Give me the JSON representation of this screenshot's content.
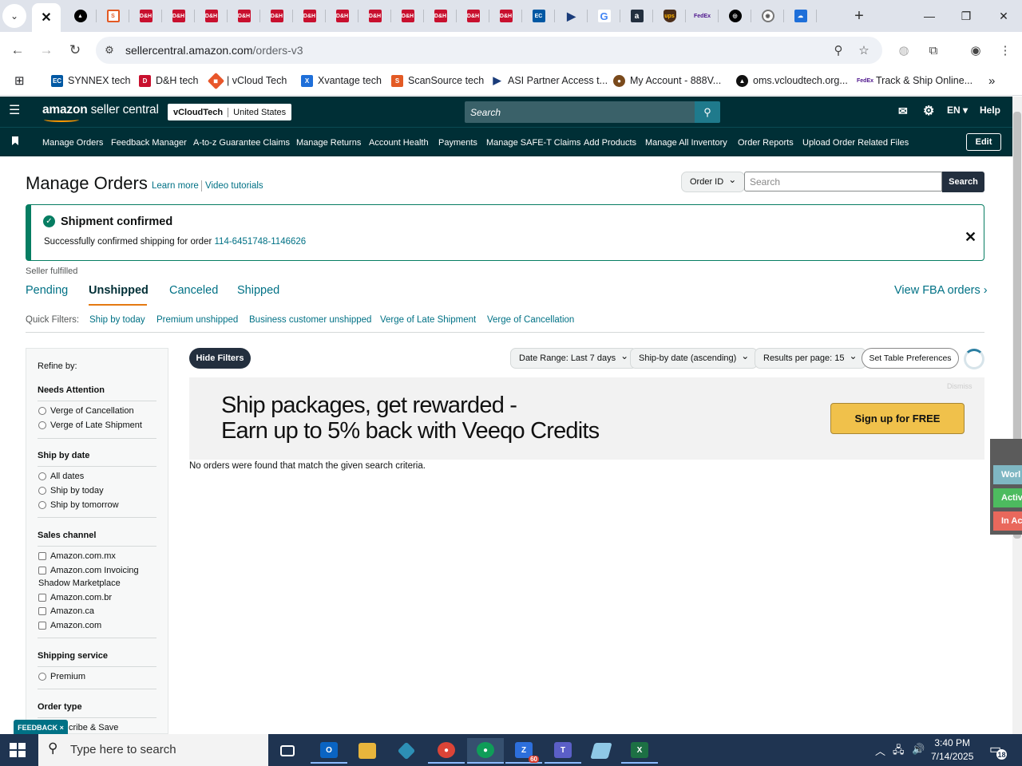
{
  "browser": {
    "url_domain": "sellercentral.amazon.com",
    "url_path": "/orders-v3",
    "favicons": [
      "tab-sellercentral",
      "tab-sharepoint",
      "tab-stackbit",
      "tab-dh-1",
      "tab-dh-2",
      "tab-dh-3",
      "tab-dh-4",
      "tab-dh-5",
      "tab-dh-6",
      "tab-dh-7",
      "tab-dh-8",
      "tab-dh-9",
      "tab-dh-10",
      "tab-dh-11",
      "tab-dh-12",
      "tab-ec",
      "tab-asi",
      "tab-google",
      "tab-amazon",
      "tab-ups",
      "tab-fedex",
      "tab-openai",
      "tab-chrome",
      "tab-cloud"
    ],
    "bookmarks": [
      {
        "label": "SYNNEX tech",
        "icon": "ec-icon",
        "color": "#0058a3"
      },
      {
        "label": "D&H tech",
        "icon": "dh-icon",
        "color": "#c8102e"
      },
      {
        "label": "| vCloud Tech",
        "icon": "vcloud-icon",
        "color": "#e8562a"
      },
      {
        "label": "Xvantage tech",
        "icon": "xvantage-icon",
        "color": "#1e6fd9"
      },
      {
        "label": "ScanSource tech",
        "icon": "scansource-icon",
        "color": "#e35a24"
      },
      {
        "label": "ASI Partner Access t...",
        "icon": "asi-icon",
        "color": "#1a3c7a"
      },
      {
        "label": "My Account - 888V...",
        "icon": "account-icon",
        "color": "#7a4a1c"
      },
      {
        "label": "oms.vcloudtech.org...",
        "icon": "oms-icon",
        "color": "#111"
      },
      {
        "label": "Track & Ship Online...",
        "icon": "fedex-icon",
        "color": "#4d148c"
      }
    ]
  },
  "amazon": {
    "logo_a": "amazon",
    "logo_b": " seller central",
    "account_name": "vCloudTech",
    "account_region": "United States",
    "search_placeholder": "Search",
    "lang": "EN",
    "help": "Help",
    "nav": [
      "Manage Orders",
      "Feedback Manager",
      "A-to-z Guarantee Claims",
      "Manage Returns",
      "Account Health",
      "Payments",
      "Manage SAFE-T Claims",
      "Add Products",
      "Manage All Inventory",
      "Order Reports",
      "Upload Order Related Files"
    ],
    "edit": "Edit"
  },
  "page": {
    "title": "Manage Orders",
    "learn_more": "Learn more",
    "video_tutorials": "Video tutorials",
    "search_type": "Order ID",
    "search_placeholder": "Search",
    "search_button": "Search",
    "alert": {
      "title": "Shipment confirmed",
      "message": "Successfully confirmed shipping for order ",
      "order_id": "114-6451748-1146626"
    },
    "fulfillment_label": "Seller fulfilled",
    "tabs": [
      "Pending",
      "Unshipped",
      "Canceled",
      "Shipped"
    ],
    "active_tab": "Unshipped",
    "fba_link": "View FBA orders ›",
    "quick_filters_label": "Quick Filters:",
    "quick_filters": [
      "Ship by today",
      "Premium unshipped",
      "Business customer unshipped",
      "Verge of Late Shipment",
      "Verge of Cancellation"
    ]
  },
  "filters": {
    "refine_by": "Refine by:",
    "needs_attention": {
      "title": "Needs Attention",
      "options": [
        "Verge of Cancellation",
        "Verge of Late Shipment"
      ]
    },
    "ship_by_date": {
      "title": "Ship by date",
      "options": [
        "All dates",
        "Ship by today",
        "Ship by tomorrow"
      ]
    },
    "sales_channel": {
      "title": "Sales channel",
      "options": [
        "Amazon.com.mx",
        "Amazon.com Invoicing",
        "Shadow Marketplace",
        "Amazon.com.br",
        "Amazon.ca",
        "Amazon.com"
      ]
    },
    "shipping_service": {
      "title": "Shipping service",
      "options": [
        "Premium"
      ]
    },
    "order_type": {
      "title": "Order type",
      "partial_option": "cribe & Save"
    }
  },
  "toolbar": {
    "hide_filters": "Hide Filters",
    "date_range": "Date Range: Last 7 days",
    "sort": "Ship-by date (ascending)",
    "per_page": "Results per page: 15",
    "table_prefs": "Set Table Preferences"
  },
  "banner": {
    "line1": "Ship packages, get rewarded -",
    "line2": "Earn up to 5% back with Veeqo Credits",
    "cta": "Sign up for FREE",
    "tag": "Dismiss"
  },
  "results": {
    "empty_message": "No orders were found that match the given search criteria."
  },
  "side_widget": [
    "Worl",
    "Activ",
    "In Ac"
  ],
  "feedback": "FEEDBACK ×",
  "taskbar": {
    "search_placeholder": "Type here to search",
    "time": "3:40 PM",
    "date": "7/14/2025",
    "zoom_badge": "60",
    "notifications": "18"
  }
}
